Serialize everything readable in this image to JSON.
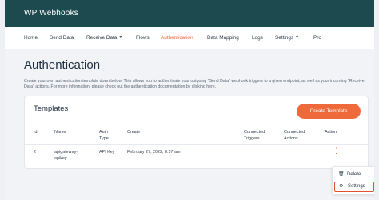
{
  "app": {
    "title": "WP Webhooks"
  },
  "nav": {
    "items": [
      {
        "label": "Home"
      },
      {
        "label": "Send Data"
      },
      {
        "label": "Receive Data",
        "has_caret": true
      },
      {
        "label": "Flows"
      },
      {
        "label": "Authentication",
        "active": true
      },
      {
        "label": "Data Mapping"
      },
      {
        "label": "Logs"
      },
      {
        "label": "Settings",
        "has_caret": true
      },
      {
        "label": "Pro"
      }
    ]
  },
  "page": {
    "title": "Authentication",
    "description": "Create your own authentication template down below. This allows you to authenticate your outgoing \"Send Data\" webhook triggers to a given endpoint, as well as your incoming \"Receive Data\" actions. For more information, please check out the authentication documentation by clicking here."
  },
  "templates": {
    "title": "Templates",
    "create_button": "Create Template",
    "columns": {
      "id": "Id",
      "name": "Name",
      "auth_type": "Auth Type",
      "create": "Create",
      "connected_triggers": "Connected Triggers",
      "connected_actions": "Connected Actions",
      "action": "Action"
    },
    "rows": [
      {
        "id": "2",
        "name": "apigateway-apikey",
        "auth_type": "API Key",
        "create": "February 27, 2022, 8:57 am"
      }
    ]
  },
  "action_menu": {
    "delete_label": "Delete",
    "settings_label": "Settings"
  },
  "colors": {
    "topbar": "#1d4a4f",
    "accent": "#ef6a3a",
    "highlight_border": "#e2512b"
  }
}
